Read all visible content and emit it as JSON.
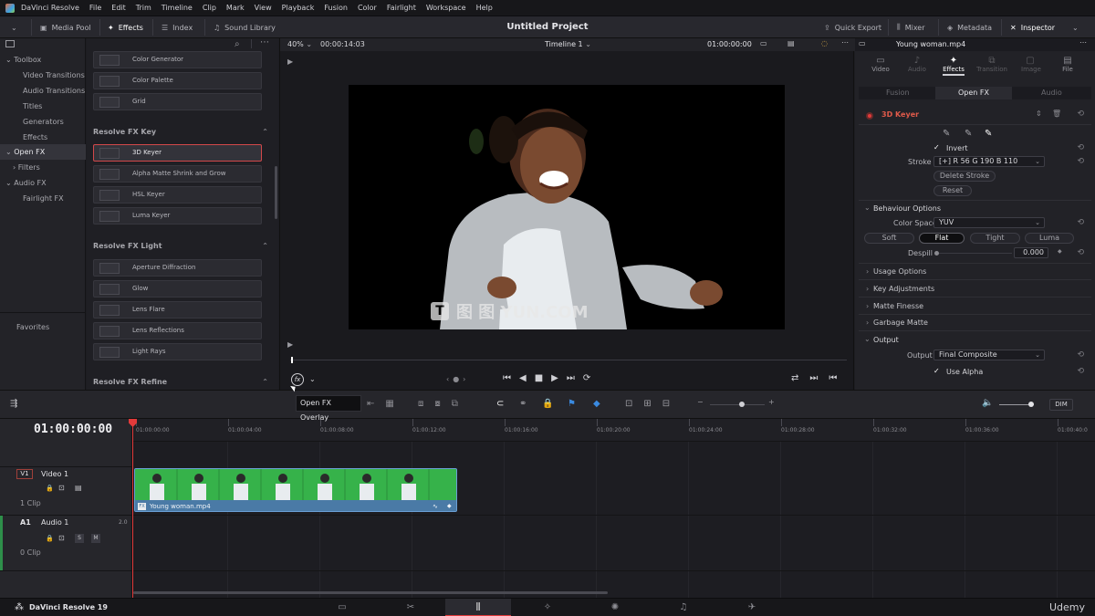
{
  "menubar": {
    "app_name": "DaVinci Resolve",
    "items": [
      "File",
      "Edit",
      "Trim",
      "Timeline",
      "Clip",
      "Mark",
      "View",
      "Playback",
      "Fusion",
      "Color",
      "Fairlight",
      "Workspace",
      "Help"
    ]
  },
  "toolbar": {
    "media_pool": "Media Pool",
    "effects": "Effects",
    "index": "Index",
    "sound_library": "Sound Library",
    "project_title": "Untitled Project",
    "quick_export": "Quick Export",
    "mixer": "Mixer",
    "metadata": "Metadata",
    "inspector": "Inspector"
  },
  "sidebar": {
    "toolbox": "Toolbox",
    "items": [
      "Video Transitions",
      "Audio Transitions",
      "Titles",
      "Generators",
      "Effects"
    ],
    "open_fx": "Open FX",
    "filters": "Filters",
    "audio_fx": "Audio FX",
    "fairlight_fx": "Fairlight FX",
    "favorites": "Favorites"
  },
  "fxlist": {
    "top_items": [
      "Color Generator",
      "Color Palette",
      "Grid"
    ],
    "key_header": "Resolve FX Key",
    "key_items": [
      "3D Keyer",
      "Alpha Matte Shrink and Grow",
      "HSL Keyer",
      "Luma Keyer"
    ],
    "light_header": "Resolve FX Light",
    "light_items": [
      "Aperture Diffraction",
      "Glow",
      "Lens Flare",
      "Lens Reflections",
      "Light Rays"
    ],
    "refine_header": "Resolve FX Refine"
  },
  "viewer": {
    "zoom": "40%",
    "timecode_left": "00:00:14:03",
    "timeline_name": "Timeline 1",
    "timecode_right": "01:00:00:00",
    "watermark": "图 图 YUN.COM"
  },
  "inspector": {
    "clip_name": "Young woman.mp4",
    "tabs": [
      "Video",
      "Audio",
      "Effects",
      "Transition",
      "Image",
      "File"
    ],
    "subtabs": [
      "Fusion",
      "Open FX",
      "Audio"
    ],
    "effect_name": "3D Keyer",
    "invert": "Invert",
    "stroke_label": "Stroke",
    "stroke_value": "[+]   R 56   G 190   B 110",
    "delete_stroke": "Delete Stroke",
    "reset": "Reset",
    "behaviour_options": "Behaviour Options",
    "color_space_label": "Color Space",
    "color_space_value": "YUV",
    "modes": [
      "Soft",
      "Flat",
      "Tight",
      "Luma"
    ],
    "despill_label": "Despill",
    "despill_value": "0.000",
    "usage_options": "Usage Options",
    "key_adjustments": "Key Adjustments",
    "matte_finesse": "Matte Finesse",
    "garbage_matte": "Garbage Matte",
    "output_section": "Output",
    "output_label": "Output",
    "output_value": "Final Composite",
    "use_alpha": "Use Alpha"
  },
  "tooltip": "Open FX Overlay",
  "timeline": {
    "timecode": "01:00:00:00",
    "ruler_ticks": [
      "01:00:00:00",
      "01:00:04:00",
      "01:00:08:00",
      "01:00:12:00",
      "01:00:16:00",
      "01:00:20:00",
      "01:00:24:00",
      "01:00:28:00",
      "01:00:32:00",
      "01:00:36:00",
      "01:00:40:0"
    ],
    "video_track_id": "V1",
    "video_track_name": "Video 1",
    "video_clip_count": "1 Clip",
    "audio_track_id": "A1",
    "audio_track_name": "Audio 1",
    "audio_level": "2.0",
    "audio_clip_count": "0 Clip",
    "clip_label": "Young woman.mp4",
    "dim": "DIM",
    "fx_badge": "FX"
  },
  "pagebar": {
    "app_version": "DaVinci Resolve 19",
    "watermark": "Udemy"
  },
  "colors": {
    "accent_red": "#e23a3a",
    "clip_green": "#36b24a",
    "clip_blue": "#4a7aa6"
  }
}
